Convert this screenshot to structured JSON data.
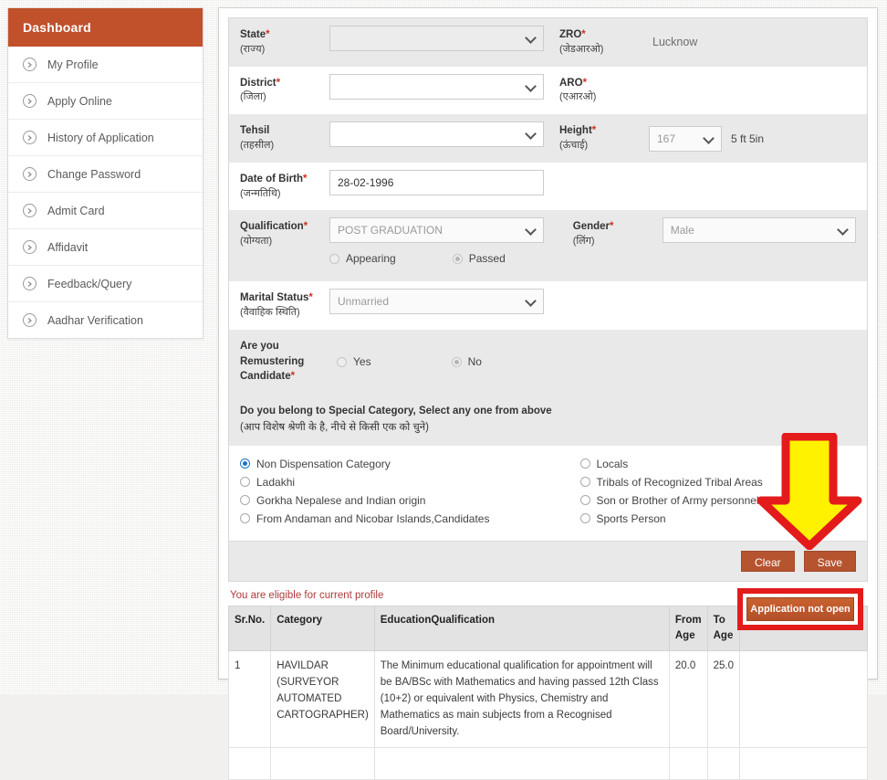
{
  "sidebar": {
    "header": "Dashboard",
    "items": [
      {
        "label": "My Profile",
        "icon": "chevron-circle-right-icon"
      },
      {
        "label": "Apply Online",
        "icon": "chevron-circle-right-icon"
      },
      {
        "label": "History of Application",
        "icon": "chevron-circle-right-icon"
      },
      {
        "label": "Change Password",
        "icon": "chevron-circle-right-icon"
      },
      {
        "label": "Admit Card",
        "icon": "chevron-circle-right-icon"
      },
      {
        "label": "Affidavit",
        "icon": "chevron-circle-right-icon"
      },
      {
        "label": "Feedback/Query",
        "icon": "chevron-circle-right-icon"
      },
      {
        "label": "Aadhar Verification",
        "icon": "chevron-circle-right-icon"
      }
    ]
  },
  "form": {
    "state": {
      "label": "State",
      "hindi": "(राज्य)",
      "required": "*",
      "value": "",
      "placeholder": ""
    },
    "zro": {
      "label": "ZRO",
      "hindi": "(जेडआरओ)",
      "required": "*",
      "value": "Lucknow"
    },
    "district": {
      "label": "District",
      "hindi": "(जिला)",
      "required": "*",
      "value": "",
      "placeholder": ""
    },
    "aro": {
      "label": "ARO",
      "hindi": "(एआरओ)",
      "required": "*",
      "value": ""
    },
    "tehsil": {
      "label": "Tehsil",
      "hindi": "(तहसील)",
      "required": "",
      "value": "",
      "placeholder": ""
    },
    "height": {
      "label": "Height",
      "hindi": "(ऊंचाई)",
      "required": "*",
      "value": "167",
      "converted": "5 ft 5in"
    },
    "dob": {
      "label": "Date of Birth",
      "hindi": "(जन्मतिथि)",
      "required": "*",
      "value": "28-02-1996"
    },
    "qualification": {
      "label": "Qualification",
      "hindi": "(योग्यता)",
      "required": "*",
      "value": "POST GRADUATION",
      "status_options": [
        {
          "label": "Appearing",
          "selected": false
        },
        {
          "label": "Passed",
          "selected": true
        }
      ]
    },
    "gender": {
      "label": "Gender",
      "hindi": "(लिंग)",
      "required": "*",
      "value": "Male"
    },
    "marital": {
      "label": "Marital Status",
      "hindi": "(वैवाहिक स्थिति)",
      "required": "*",
      "value": "Unmarried"
    },
    "remustering": {
      "label_line1": "Are you Remustering",
      "label_line2": "Candidate",
      "required": "*",
      "options": [
        {
          "label": "Yes",
          "selected": false
        },
        {
          "label": "No",
          "selected": true
        }
      ]
    },
    "special_category": {
      "heading": "Do you belong to Special Category, Select any one from above",
      "heading_hindi": "(आप विशेष श्रेणी के है, नीचे से किसी एक को चुने)",
      "left_options": [
        {
          "label": "Non Dispensation Category",
          "selected": true
        },
        {
          "label": "Ladakhi",
          "selected": false
        },
        {
          "label": "Gorkha Nepalese and Indian origin",
          "selected": false
        },
        {
          "label": "From Andaman and Nicobar Islands,Candidates",
          "selected": false
        }
      ],
      "right_options": [
        {
          "label": "Locals",
          "selected": false
        },
        {
          "label": "Tribals of Recognized Tribal Areas",
          "selected": false
        },
        {
          "label": "Son or Brother of Army personnel",
          "selected": false
        },
        {
          "label": "Sports Person",
          "selected": false
        }
      ]
    },
    "buttons": [
      {
        "label": "Clear"
      },
      {
        "label": "Save"
      }
    ]
  },
  "eligibility": {
    "note": "You are eligible for current profile",
    "columns": [
      "Sr.No.",
      "Category",
      "EducationQualification",
      "From Age",
      "To Age",
      ""
    ],
    "rows": [
      {
        "sr_no": "1",
        "category": "HAVILDAR (SURVEYOR AUTOMATED CARTOGRAPHER)",
        "education_qualification": "The Minimum educational qualification for appointment will be BA/BSc with Mathematics and having passed 12th Class (10+2) or equivalent with Physics, Chemistry and Mathematics as main subjects from a Recognised Board/University.",
        "from_age": "20.0",
        "to_age": "25.0",
        "action": "Application not open"
      }
    ]
  },
  "annotation": {
    "arrow": "down-arrow-callout",
    "arrow_fill": "#FFF200",
    "arrow_stroke": "#E31B1B",
    "highlight_color": "#E31B1B"
  }
}
